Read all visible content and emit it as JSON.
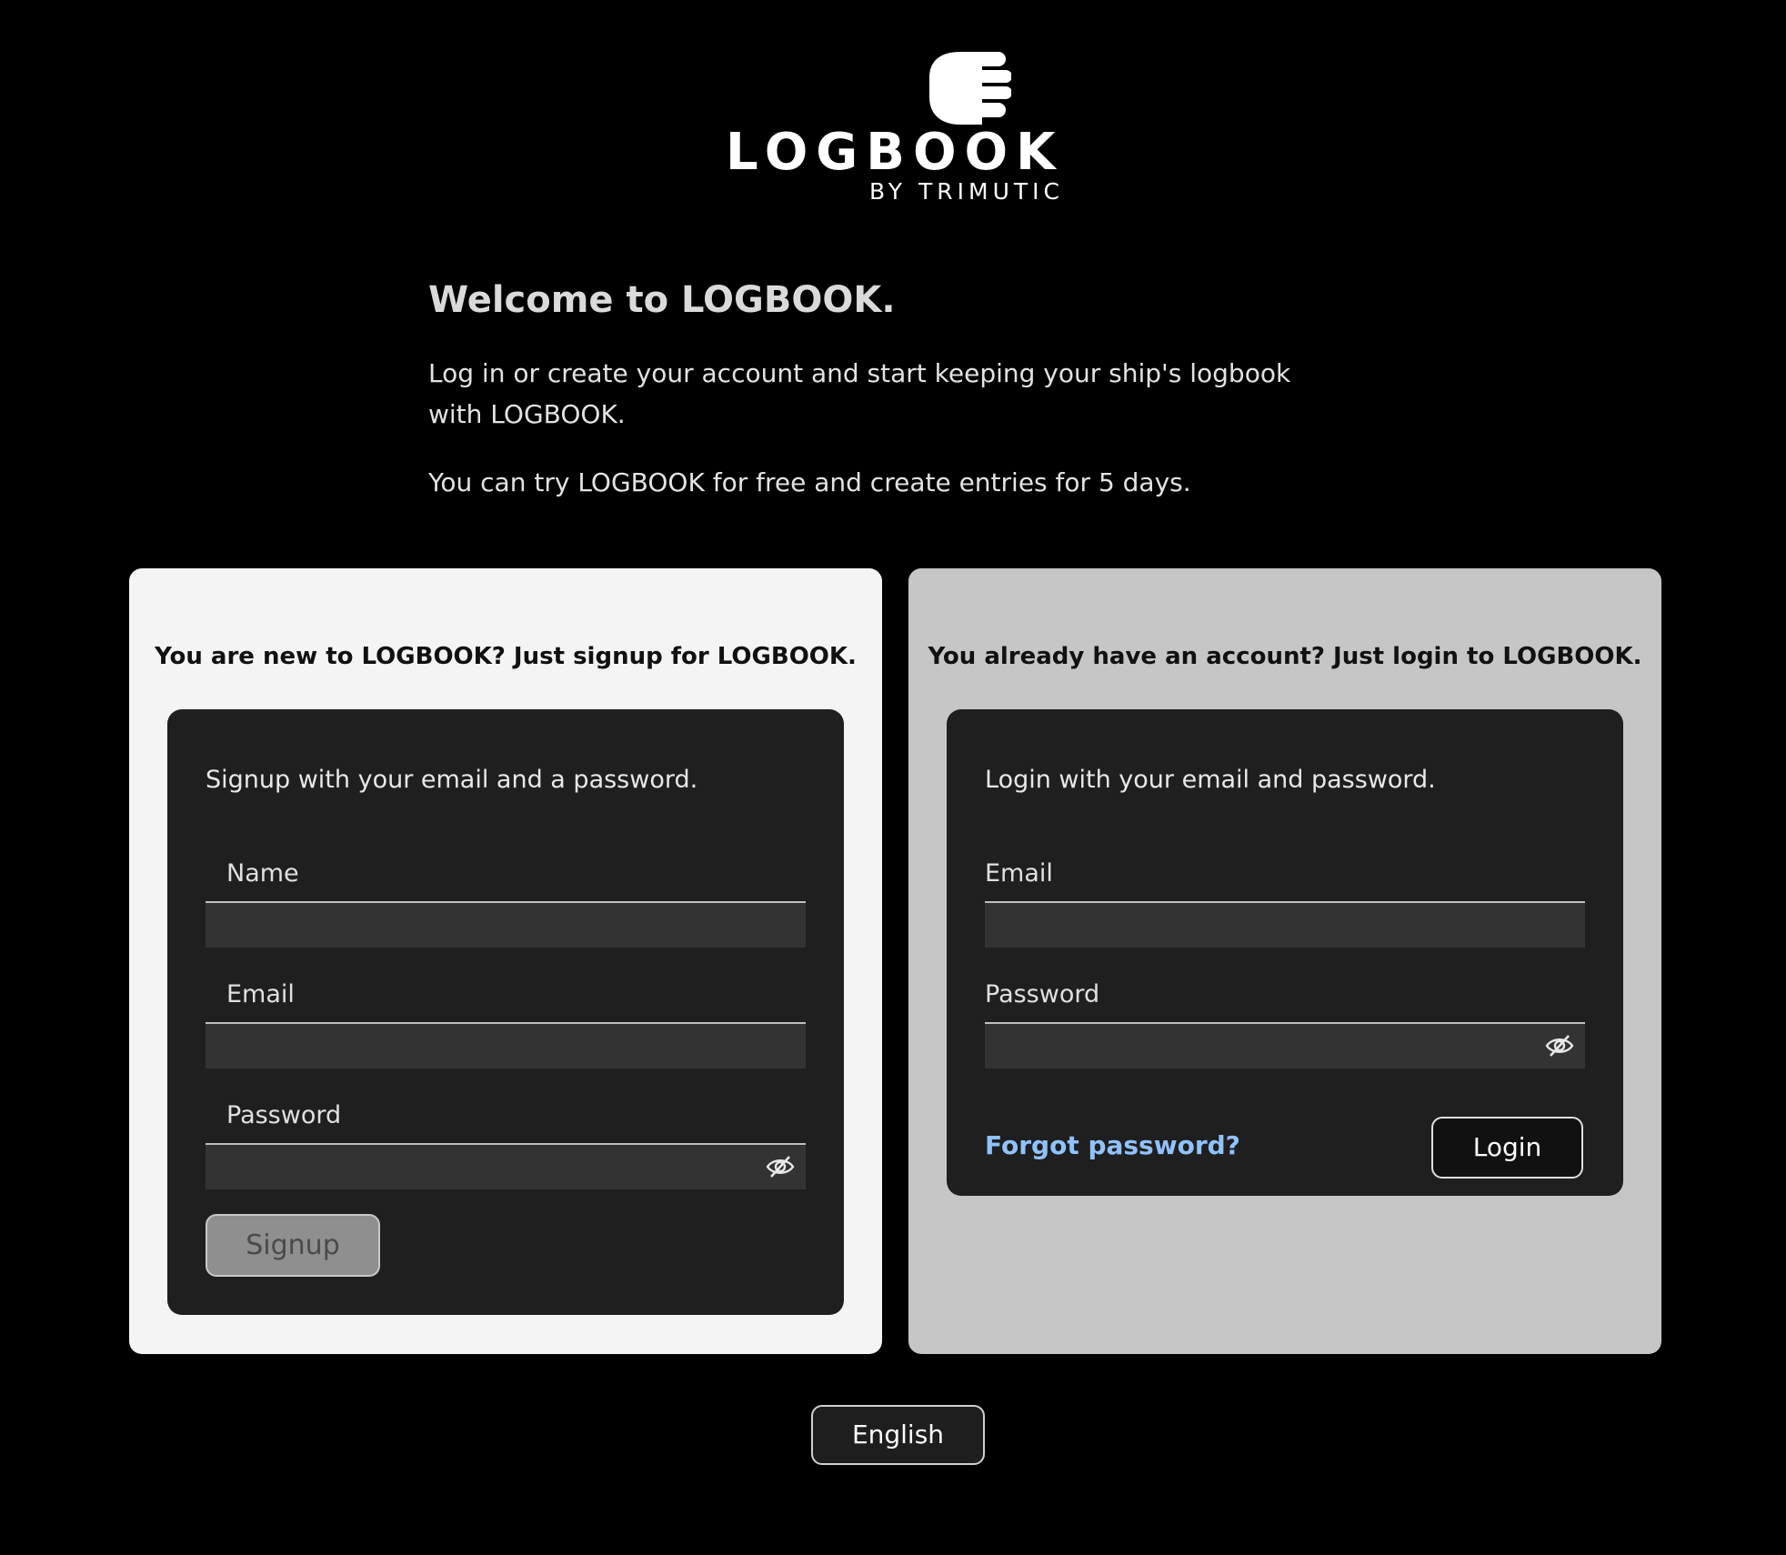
{
  "brand": {
    "name": "LOGBOOK",
    "byline": "BY TRIMUTIC",
    "logo_icon": "logbook-hand-icon"
  },
  "intro": {
    "title": "Welcome to LOGBOOK.",
    "paragraph1": "Log in or create your account and start keeping your ship's logbook with LOGBOOK.",
    "paragraph2": "You can try LOGBOOK for free and create entries for 5 days."
  },
  "signup": {
    "heading": "You are new to LOGBOOK? Just signup for LOGBOOK.",
    "intro": "Signup with your email and a password.",
    "name_label": "Name",
    "name_value": "",
    "email_label": "Email",
    "email_value": "",
    "password_label": "Password",
    "password_value": "",
    "toggle_icon": "eye-slash-icon",
    "button_label": "Signup"
  },
  "login": {
    "heading": "You already have an account? Just login to LOGBOOK.",
    "intro": "Login with your email and password.",
    "email_label": "Email",
    "email_value": "",
    "password_label": "Password",
    "password_value": "",
    "toggle_icon": "eye-slash-icon",
    "forgot_label": "Forgot password?",
    "button_label": "Login"
  },
  "footer": {
    "language_label": "English"
  },
  "colors": {
    "background": "#000000",
    "signup_panel": "#f4f4f4",
    "login_panel": "#c6c6c6",
    "card": "#1f1f1f",
    "input": "#333333",
    "link": "#8fc3ff"
  }
}
